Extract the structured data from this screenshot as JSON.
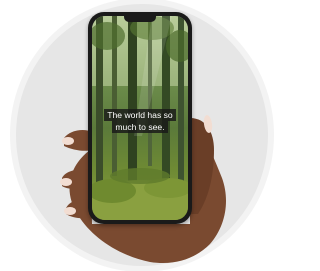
{
  "caption": {
    "line1": "The world has so",
    "line2": "much to see."
  },
  "colors": {
    "circle": "#e6e6e6",
    "phone_frame": "#1a1a1a",
    "skin": "#7a4a30",
    "forest_dark": "#2f4a20",
    "moss": "#8aa040",
    "caption_bg": "#191919"
  },
  "icons": {
    "scene": "forest-photo"
  }
}
